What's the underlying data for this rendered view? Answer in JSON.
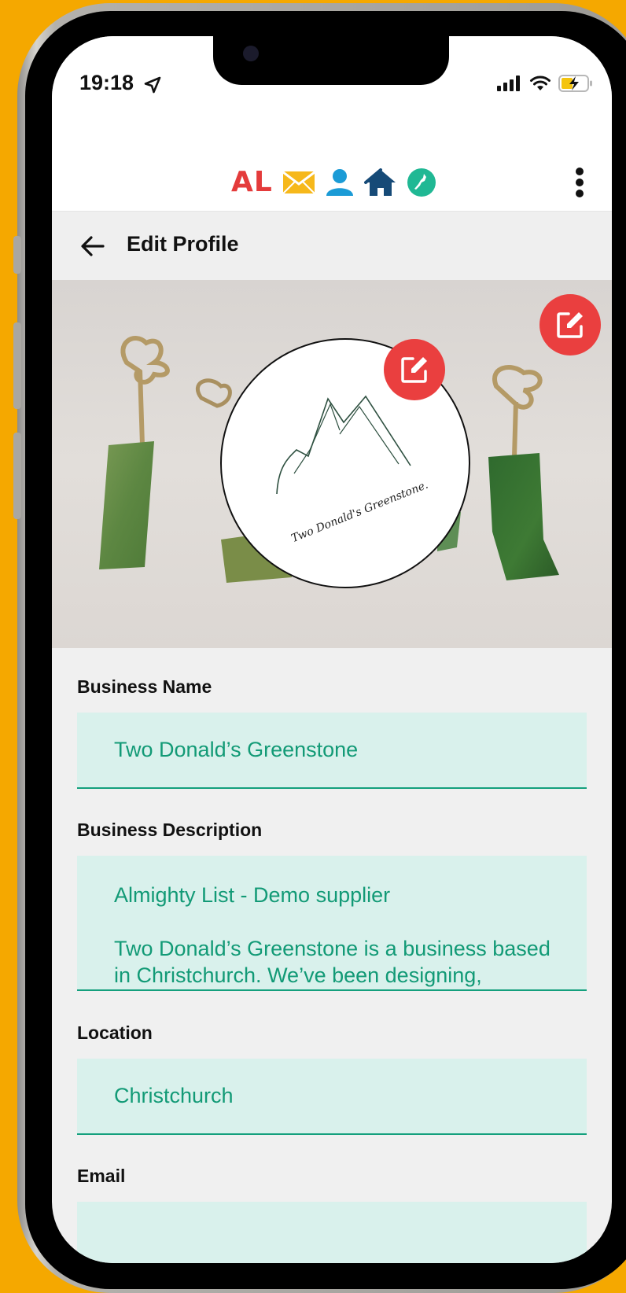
{
  "status_bar": {
    "time": "19:18"
  },
  "header": {
    "logo_text": "AL",
    "icons": [
      "mail-icon",
      "user-icon",
      "home-icon",
      "nz-map-icon"
    ],
    "colors": {
      "logo_red": "#e43b3b",
      "mail_yellow": "#f6b81b",
      "user_blue": "#1b9bd6",
      "home_navy": "#164a77",
      "map_green": "#20b894"
    }
  },
  "title_bar": {
    "title": "Edit Profile"
  },
  "banner": {
    "logo_script": "Two Donald's Greenstone."
  },
  "form": {
    "business_name": {
      "label": "Business Name",
      "value": "Two Donald’s Greenstone"
    },
    "business_description": {
      "label": "Business Description",
      "value": "Almighty List - Demo supplier\n\nTwo Donald’s Greenstone is a business based in Christchurch. We’ve been designing,"
    },
    "location": {
      "label": "Location",
      "value": "Christchurch"
    },
    "email": {
      "label": "Email",
      "value": ""
    }
  },
  "colors": {
    "accent": "#14a07d",
    "field_bg": "#d9f1ec",
    "fab_red": "#ea3f3f",
    "background_frame": "#f5a800"
  }
}
